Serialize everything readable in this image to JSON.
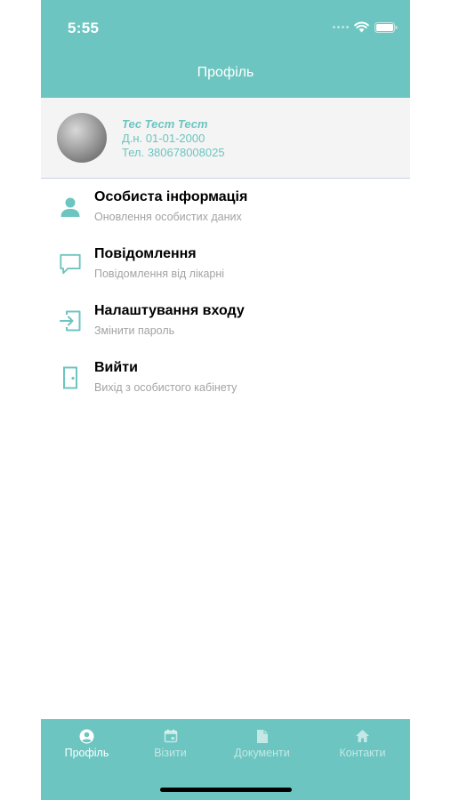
{
  "status_bar": {
    "time": "5:55"
  },
  "header": {
    "title": "Профіль"
  },
  "profile": {
    "name": "Тес Тест Тест",
    "birth": "Д.н. 01-01-2000",
    "phone": "Тел.  380678008025"
  },
  "menu": [
    {
      "title": "Особиста інформація",
      "subtitle": "Оновлення особистих даних",
      "icon": "person-icon"
    },
    {
      "title": "Повідомлення",
      "subtitle": "Повідомлення від лікарні",
      "icon": "chat-bubble-icon"
    },
    {
      "title": "Налаштування входу",
      "subtitle": "Змінити пароль",
      "icon": "login-icon"
    },
    {
      "title": "Вийти",
      "subtitle": "Вихід з особистого кабінету",
      "icon": "door-icon"
    }
  ],
  "tabs": [
    {
      "label": "Профіль",
      "icon": "profile-icon",
      "active": true
    },
    {
      "label": "Візити",
      "icon": "calendar-icon",
      "active": false
    },
    {
      "label": "Документи",
      "icon": "document-icon",
      "active": false
    },
    {
      "label": "Контакти",
      "icon": "home-icon",
      "active": false
    }
  ],
  "colors": {
    "accent": "#6cc5c0",
    "card_background": "#f4f4f4",
    "title_text": "#000000",
    "subtitle_text": "#a3a3a3"
  }
}
